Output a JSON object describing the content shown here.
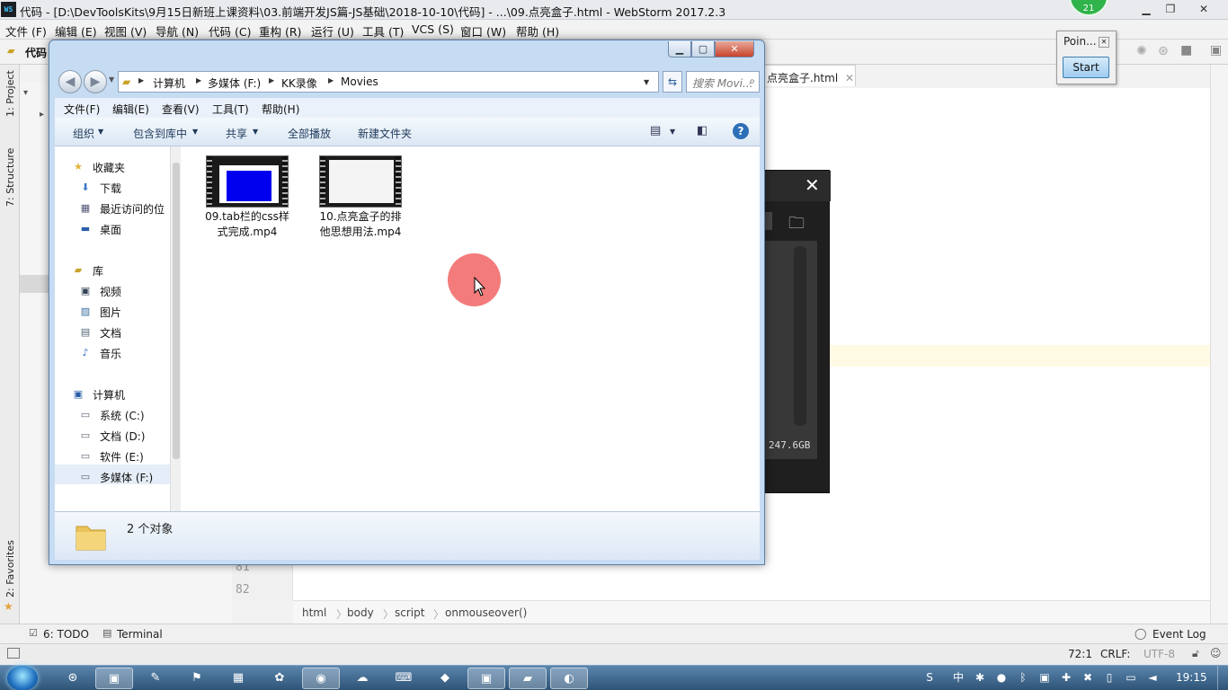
{
  "webstorm": {
    "logo": "WS",
    "title": "代码 - [D:\\DevToolsKits\\9月15日新班上课资料\\03.前端开发JS篇-JS基础\\2018-10-10\\代码] - ...\\09.点亮盒子.html - WebStorm 2017.2.3",
    "menu": [
      "文件 (F)",
      "编辑 (E)",
      "视图 (V)",
      "导航 (N)",
      "代码 (C)",
      "重构 (R)",
      "运行 (U)",
      "工具 (T)",
      "VCS (S)",
      "窗口 (W)",
      "帮助 (H)"
    ],
    "project_root": "代码",
    "editor_tab": "点亮盒子.html",
    "left_tool_windows": [
      "1: Project",
      "7: Structure",
      "2: Favorites"
    ],
    "line_numbers": [
      "81",
      "82"
    ],
    "breadcrumbs": [
      "html",
      "body",
      "script",
      "onmouseover()"
    ],
    "bottom_tools": [
      "6: TODO",
      "Terminal",
      "Event Log"
    ],
    "status": {
      "position": "72:1",
      "line_sep": "CRLF:",
      "encoding": "UTF-8"
    }
  },
  "recorder_badge": "21",
  "pointer_popup": {
    "title": "Poin...",
    "start": "Start"
  },
  "recorder_dialog": {
    "disk_free": "247.6GB"
  },
  "explorer": {
    "address": [
      "计算机",
      "多媒体 (F:)",
      "KK录像",
      "Movies"
    ],
    "search_placeholder": "搜索 Movi...",
    "menu": [
      "文件(F)",
      "编辑(E)",
      "查看(V)",
      "工具(T)",
      "帮助(H)"
    ],
    "commands": [
      "组织",
      "包含到库中",
      "共享",
      "全部播放",
      "新建文件夹"
    ],
    "nav": {
      "favorites": "收藏夹",
      "favorites_items": [
        "下载",
        "最近访问的位",
        "桌面"
      ],
      "libraries": "库",
      "library_items": [
        "视频",
        "图片",
        "文档",
        "音乐"
      ],
      "computer": "计算机",
      "drives": [
        "系统 (C:)",
        "文档 (D:)",
        "软件 (E:)",
        "多媒体 (F:)"
      ]
    },
    "files": [
      {
        "line1": "09.tab栏的css样",
        "line2": "式完成.mp4"
      },
      {
        "line1": "10.点亮盒子的排",
        "line2": "他思想用法.mp4"
      }
    ],
    "status_count": "2 个对象"
  },
  "taskbar": {
    "clock": "19:15"
  }
}
